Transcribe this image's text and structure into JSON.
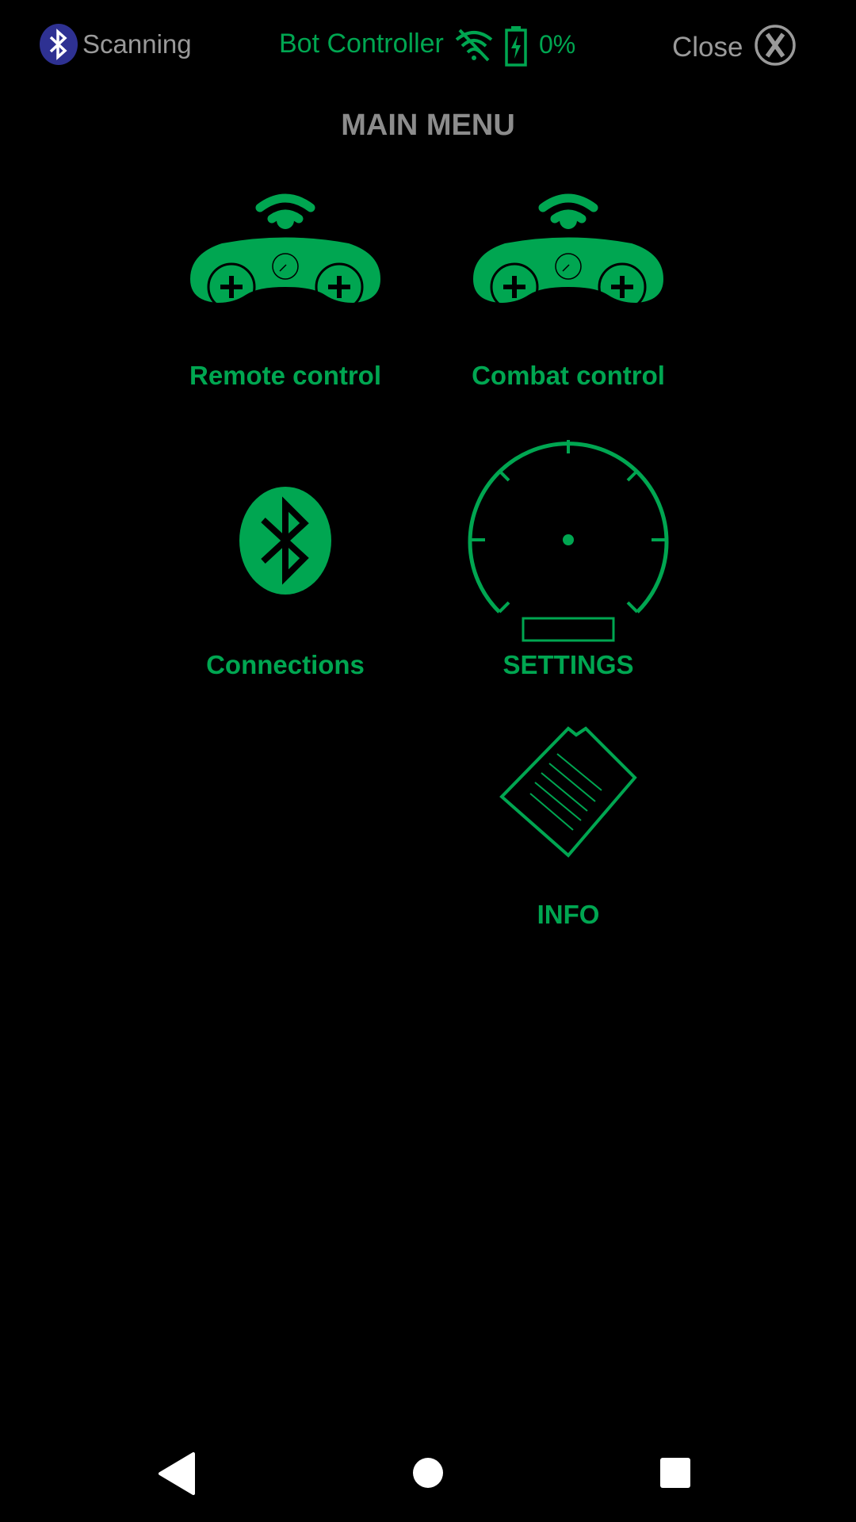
{
  "colors": {
    "background": "#000000",
    "accent_green": "#00a651",
    "muted_gray": "#9a9a9a",
    "bluetooth_blue": "#2e3192",
    "nav_white": "#ffffff"
  },
  "status_bar": {
    "bluetooth_status": "Scanning",
    "bluetooth_icon": "bluetooth-icon",
    "app_title": "Bot Controller",
    "signal_icon": "wifi-off-icon",
    "battery_icon": "battery-charging-icon",
    "battery_level": "0%",
    "close_label": "Close",
    "close_icon": "close-x-icon"
  },
  "menu": {
    "title": "MAIN MENU",
    "items": [
      {
        "label": "Remote control",
        "icon": "gamepad-wireless-icon"
      },
      {
        "label": "Combat control",
        "icon": "gamepad-wireless-icon"
      },
      {
        "label": "Connections",
        "icon": "bluetooth-icon"
      },
      {
        "label": "SETTINGS",
        "icon": "gauge-icon"
      },
      {
        "label": "INFO",
        "icon": "document-icon"
      }
    ]
  },
  "navigation": {
    "back_icon": "back-triangle-icon",
    "home_icon": "home-circle-icon",
    "recents_icon": "recents-square-icon"
  }
}
